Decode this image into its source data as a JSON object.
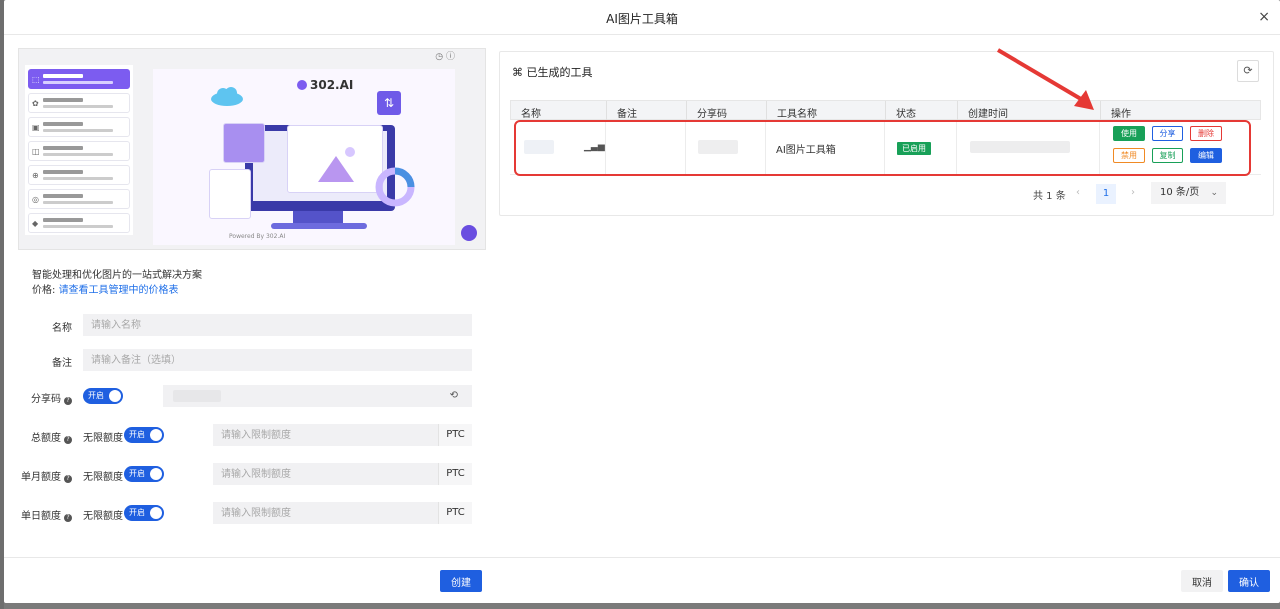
{
  "modal": {
    "title": "AI图片工具箱",
    "close": "×"
  },
  "preview": {
    "logo": "302.AI",
    "powered": "Powered By 302.AI"
  },
  "left": {
    "description": "智能处理和优化图片的一站式解决方案",
    "price_label": "价格:",
    "price_link": "请查看工具管理中的价格表",
    "fields": {
      "name": {
        "label": "名称",
        "placeholder": "请输入名称"
      },
      "note": {
        "label": "备注",
        "placeholder": "请输入备注（选填）"
      },
      "share_code": {
        "label": "分享码",
        "toggle": "开启"
      },
      "total_quota": {
        "label": "总额度",
        "unlimited": "无限额度",
        "toggle": "开启",
        "placeholder": "请输入限制额度",
        "suffix": "PTC"
      },
      "monthly_quota": {
        "label": "单月额度",
        "unlimited": "无限额度",
        "toggle": "开启",
        "placeholder": "请输入限制额度",
        "suffix": "PTC"
      },
      "daily_quota": {
        "label": "单日额度",
        "unlimited": "无限额度",
        "toggle": "开启",
        "placeholder": "请输入限制额度",
        "suffix": "PTC"
      }
    }
  },
  "right": {
    "title": "⌘ 已生成的工具",
    "refresh_icon": "refresh-icon",
    "columns": [
      "名称",
      "备注",
      "分享码",
      "工具名称",
      "状态",
      "创建时间",
      "操作"
    ],
    "rows": [
      {
        "tool_name": "AI图片工具箱",
        "status": "已启用",
        "actions": [
          "使用",
          "分享",
          "删除",
          "禁用",
          "复制",
          "编辑"
        ]
      }
    ],
    "pager": {
      "total": "共 1 条",
      "current": "1",
      "page_size": "10 条/页"
    }
  },
  "footer": {
    "create": "创建",
    "cancel": "取消",
    "confirm": "确认"
  },
  "colors": {
    "primary": "#1f5fe0",
    "success": "#18a058",
    "danger": "#e53935",
    "warning": "#f08a24"
  }
}
